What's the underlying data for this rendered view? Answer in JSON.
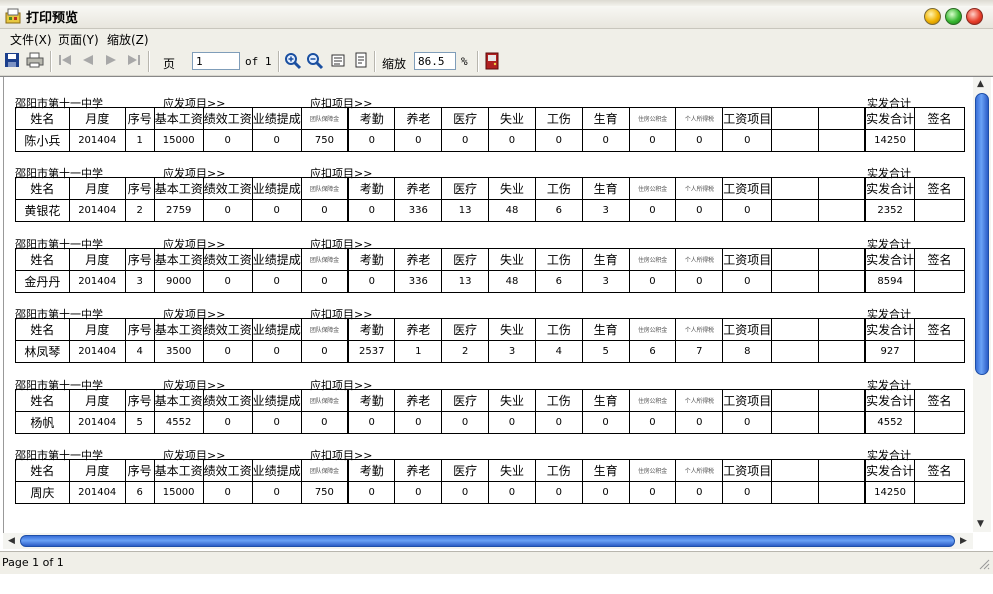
{
  "window": {
    "title": "打印预览"
  },
  "menu": {
    "items": [
      "文件(X)",
      "页面(Y)",
      "缩放(Z)"
    ]
  },
  "toolbar": {
    "page_label": "页",
    "page_value": "1",
    "of_label": "of 1",
    "zoom_label": "缩放",
    "zoom_value": "86.5",
    "percent_label": "%"
  },
  "report": {
    "school": "邵阳市第十一中学",
    "section_payable": "应发项目>>",
    "section_deduct": "应扣项目>>",
    "section_net": "实发合计",
    "headers": [
      "姓名",
      "月度",
      "序号",
      "基本工资",
      "绩效工资",
      "业绩提成",
      "团队保障金",
      "考勤",
      "养老",
      "医疗",
      "失业",
      "工伤",
      "生育",
      "住房公积金",
      "个人所得税",
      "工资项目",
      "",
      "",
      "实发合计",
      "签名"
    ],
    "rows": [
      [
        "陈小兵",
        "201404",
        "1",
        "15000",
        "0",
        "0",
        "750",
        "0",
        "0",
        "0",
        "0",
        "0",
        "0",
        "0",
        "0",
        "0",
        "",
        "",
        "14250",
        ""
      ],
      [
        "黄银花",
        "201404",
        "2",
        "2759",
        "0",
        "0",
        "0",
        "0",
        "336",
        "13",
        "48",
        "6",
        "3",
        "0",
        "0",
        "0",
        "",
        "",
        "2352",
        ""
      ],
      [
        "金丹丹",
        "201404",
        "3",
        "9000",
        "0",
        "0",
        "0",
        "0",
        "336",
        "13",
        "48",
        "6",
        "3",
        "0",
        "0",
        "0",
        "",
        "",
        "8594",
        ""
      ],
      [
        "林凤琴",
        "201404",
        "4",
        "3500",
        "0",
        "0",
        "0",
        "2537",
        "1",
        "2",
        "3",
        "4",
        "5",
        "6",
        "7",
        "8",
        "",
        "",
        "927",
        ""
      ],
      [
        "杨帆",
        "201404",
        "5",
        "4552",
        "0",
        "0",
        "0",
        "0",
        "0",
        "0",
        "0",
        "0",
        "0",
        "0",
        "0",
        "0",
        "",
        "",
        "4552",
        ""
      ],
      [
        "周庆",
        "201404",
        "6",
        "15000",
        "0",
        "0",
        "750",
        "0",
        "0",
        "0",
        "0",
        "0",
        "0",
        "0",
        "0",
        "0",
        "",
        "",
        "14250",
        ""
      ]
    ]
  },
  "status": {
    "text": "Page 1 of 1"
  }
}
